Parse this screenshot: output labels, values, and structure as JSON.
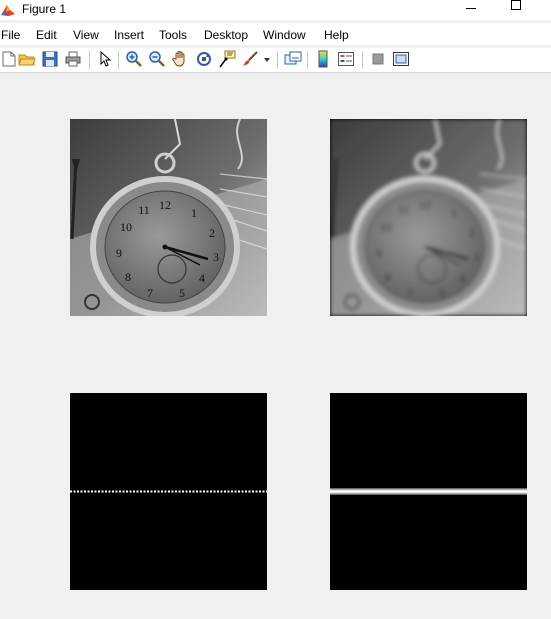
{
  "window": {
    "title": "Figure 1"
  },
  "menu": {
    "file": "File",
    "edit": "Edit",
    "view": "View",
    "insert": "Insert",
    "tools": "Tools",
    "desktop": "Desktop",
    "window": "Window",
    "help": "Help"
  },
  "toolbar": {
    "icons": [
      "new-figure-icon",
      "open-file-icon",
      "save-icon",
      "print-icon",
      "edit-plot-arrow-icon",
      "zoom-in-icon",
      "zoom-out-icon",
      "pan-hand-icon",
      "rotate-3d-icon",
      "data-cursor-icon",
      "brush-icon",
      "link-plot-icon",
      "insert-colorbar-icon",
      "insert-legend-icon",
      "hide-plot-tools-icon",
      "show-plot-tools-icon"
    ]
  },
  "figures": [
    {
      "name": "original-clock-image",
      "kind": "grayscale photo (sharp)"
    },
    {
      "name": "filtered-clock-image",
      "kind": "grayscale photo (blurred)"
    },
    {
      "name": "filter-spectrum-left",
      "kind": "black image with thin dotted horizontal line"
    },
    {
      "name": "filter-spectrum-right",
      "kind": "black image with bright horizontal band"
    }
  ],
  "colors": {
    "background": "#f0f0f0",
    "axes": "#000000",
    "accent": "#e2461f"
  }
}
